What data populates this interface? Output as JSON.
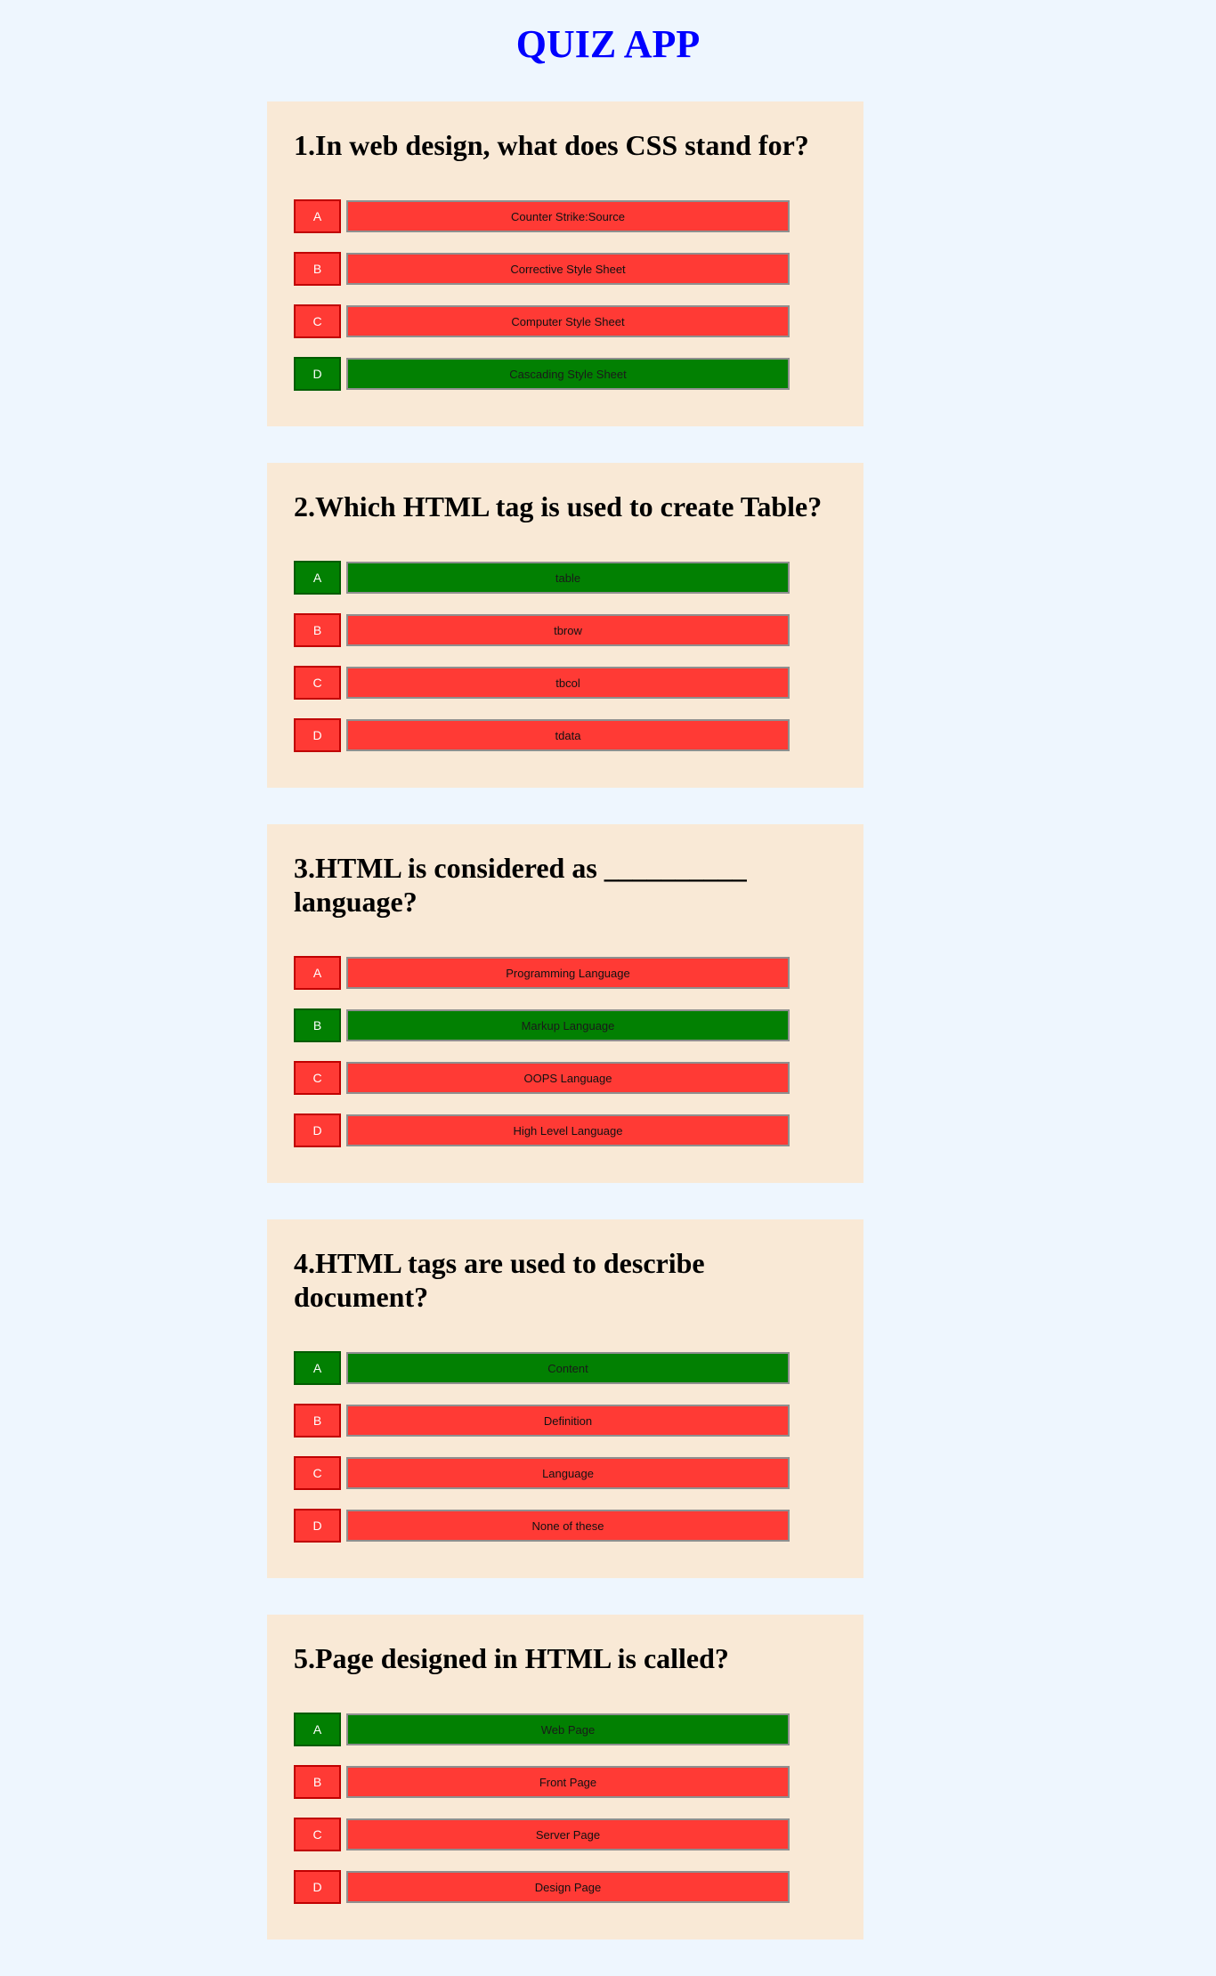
{
  "app": {
    "title": "QUIZ APP"
  },
  "colors": {
    "background": "#eef6fe",
    "card": "#f9e9d6",
    "title": "#0000ff",
    "wrong": "#ff3a35",
    "correct": "#028002"
  },
  "questions": [
    {
      "text": "1.In web design, what does CSS stand for?",
      "options": [
        {
          "letter": "A",
          "label": "Counter Strike:Source",
          "correct": false
        },
        {
          "letter": "B",
          "label": "Corrective Style Sheet",
          "correct": false
        },
        {
          "letter": "C",
          "label": "Computer Style Sheet",
          "correct": false
        },
        {
          "letter": "D",
          "label": "Cascading Style Sheet",
          "correct": true
        }
      ]
    },
    {
      "text": "2.Which HTML tag is used to create Table?",
      "options": [
        {
          "letter": "A",
          "label": "table",
          "correct": true
        },
        {
          "letter": "B",
          "label": "tbrow",
          "correct": false
        },
        {
          "letter": "C",
          "label": "tbcol",
          "correct": false
        },
        {
          "letter": "D",
          "label": "tdata",
          "correct": false
        }
      ]
    },
    {
      "text": "3.HTML is considered as __________ language?",
      "options": [
        {
          "letter": "A",
          "label": "Programming Language",
          "correct": false
        },
        {
          "letter": "B",
          "label": "Markup Language",
          "correct": true
        },
        {
          "letter": "C",
          "label": "OOPS Language",
          "correct": false
        },
        {
          "letter": "D",
          "label": "High Level Language",
          "correct": false
        }
      ]
    },
    {
      "text": "4.HTML tags are used to describe document?",
      "options": [
        {
          "letter": "A",
          "label": "Content",
          "correct": true
        },
        {
          "letter": "B",
          "label": "Definition",
          "correct": false
        },
        {
          "letter": "C",
          "label": "Language",
          "correct": false
        },
        {
          "letter": "D",
          "label": "None of these",
          "correct": false
        }
      ]
    },
    {
      "text": "5.Page designed in HTML is called?",
      "options": [
        {
          "letter": "A",
          "label": "Web Page",
          "correct": true
        },
        {
          "letter": "B",
          "label": "Front Page",
          "correct": false
        },
        {
          "letter": "C",
          "label": "Server Page",
          "correct": false
        },
        {
          "letter": "D",
          "label": "Design Page",
          "correct": false
        }
      ]
    }
  ]
}
